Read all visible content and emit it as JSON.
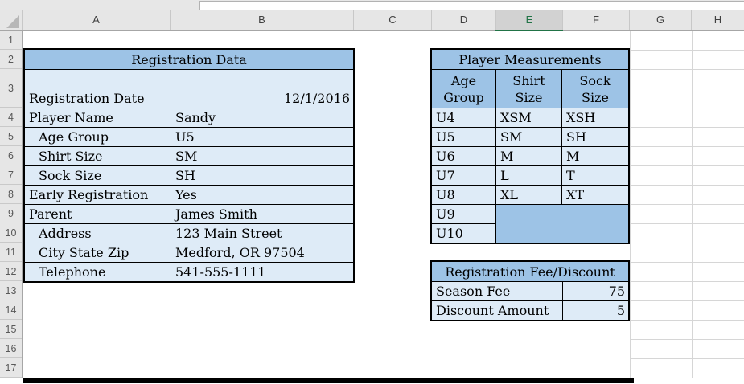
{
  "grid": {
    "col_headers": [
      "A",
      "B",
      "C",
      "D",
      "E",
      "F",
      "G",
      "H"
    ],
    "selected_column": "E",
    "row_numbers": [
      "1",
      "2",
      "3",
      "4",
      "5",
      "6",
      "7",
      "8",
      "9",
      "10",
      "11",
      "12",
      "13",
      "14",
      "15",
      "16",
      "17"
    ]
  },
  "tables": {
    "registration": {
      "title": "Registration Data",
      "rows": [
        {
          "label": "Registration Date",
          "value": "12/1/2016"
        },
        {
          "label": "Player Name",
          "value": "Sandy"
        },
        {
          "label": "Age Group",
          "value": "U5"
        },
        {
          "label": "Shirt Size",
          "value": "SM"
        },
        {
          "label": "Sock Size",
          "value": "SH"
        },
        {
          "label": "Early Registration",
          "value": "Yes"
        },
        {
          "label": "Parent",
          "value": "James Smith"
        },
        {
          "label": "Address",
          "value": "123 Main Street"
        },
        {
          "label": "City State Zip",
          "value": "Medford, OR 97504"
        },
        {
          "label": "Telephone",
          "value": "541-555-1111"
        }
      ]
    },
    "measurements": {
      "title": "Player Measurements",
      "col_headers": [
        [
          "Age",
          "Group"
        ],
        [
          "Shirt",
          "Size"
        ],
        [
          "Sock",
          "Size"
        ]
      ],
      "rows": [
        [
          "U4",
          "XSM",
          "XSH"
        ],
        [
          "U5",
          "SM",
          "SH"
        ],
        [
          "U6",
          "M",
          "M"
        ],
        [
          "U7",
          "L",
          "T"
        ],
        [
          "U8",
          "XL",
          "XT"
        ]
      ],
      "extra_age_groups": [
        "U9",
        "U10"
      ]
    },
    "fee": {
      "title": "Registration Fee/Discount",
      "rows": [
        {
          "label": "Season Fee",
          "value": "75"
        },
        {
          "label": "Discount Amount",
          "value": "5"
        }
      ]
    }
  },
  "colors": {
    "header_blue": "#9DC3E6",
    "cell_blue": "#DEEBF7",
    "selection_green": "#217346",
    "gridline_gray": "#d6d6d6",
    "band_gray": "#e6e6e6"
  }
}
